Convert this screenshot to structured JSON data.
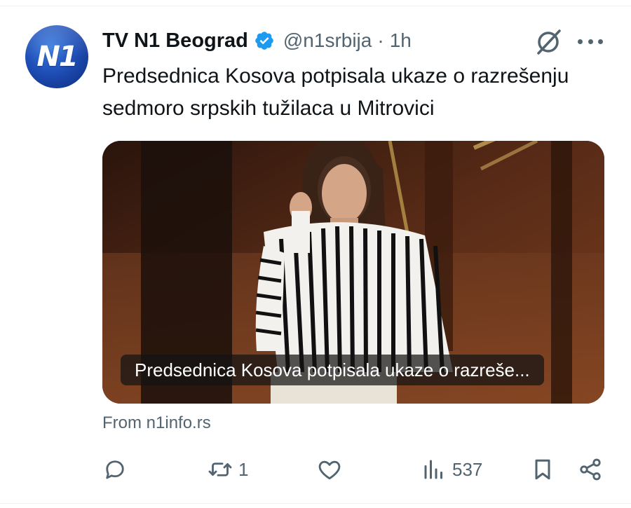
{
  "account": {
    "name": "TV N1 Beograd",
    "handle": "@n1srbija",
    "separator": "·",
    "time": "1h",
    "avatar_text": "N1",
    "verified_color": "#1d9bf0"
  },
  "tweet": {
    "text": "Predsednica Kosova potpisala ukaze o razrešenju sedmoro srpskih tužilaca u Mitrovici"
  },
  "card": {
    "caption": "Predsednica Kosova potpisala ukaze o razreše...",
    "source": "From n1info.rs"
  },
  "actions": {
    "reply_count": "",
    "retweet_count": "1",
    "like_count": "",
    "views_count": "537"
  },
  "icons": [
    "mute-icon",
    "more-icon",
    "verified-icon",
    "reply-icon",
    "retweet-icon",
    "like-icon",
    "views-icon",
    "bookmark-icon",
    "share-icon"
  ],
  "colors": {
    "text": "#0f1419",
    "secondary": "#536471",
    "accent": "#1d9bf0"
  }
}
